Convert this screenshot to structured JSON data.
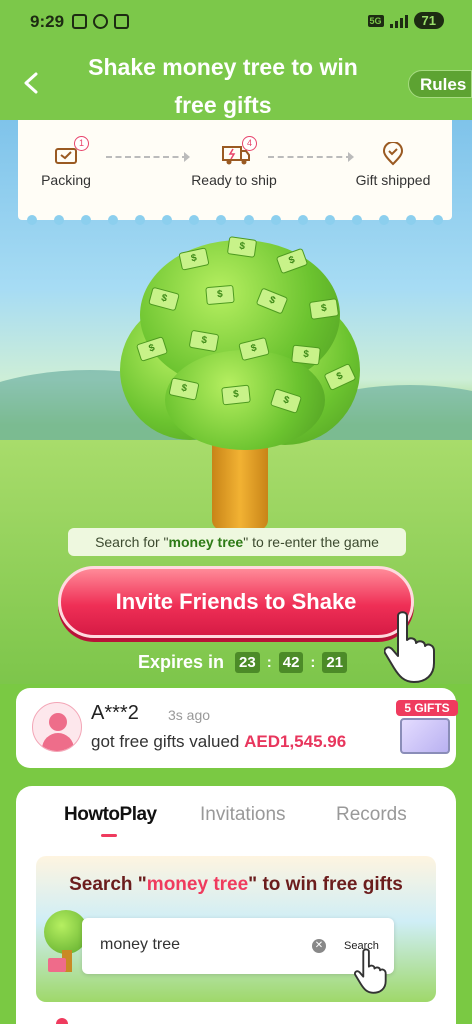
{
  "status_bar": {
    "time": "9:29",
    "network": "5G",
    "battery": "71"
  },
  "header": {
    "title": "Shake money tree to win free gifts",
    "rules_label": "Rules"
  },
  "progress": {
    "steps": [
      {
        "label": "Packing",
        "badge": "1"
      },
      {
        "label": "Ready to ship",
        "badge": "4"
      },
      {
        "label": "Gift shipped"
      }
    ]
  },
  "tree_hint": {
    "prefix": "Search for \"",
    "keyword": "money tree",
    "suffix": "\" to re-enter the game"
  },
  "invite_button": {
    "label": "Invite Friends to Shake"
  },
  "expires": {
    "label": "Expires in",
    "hours": "23",
    "minutes": "42",
    "seconds": "21"
  },
  "activity": {
    "user": "A***2",
    "time_ago": "3s ago",
    "message": "got free gifts valued",
    "amount": "AED1,545.96",
    "gifts_badge": "5 GIFTS"
  },
  "tabs": [
    {
      "label": "HowtoPlay",
      "active": true
    },
    {
      "label": "Invitations",
      "active": false
    },
    {
      "label": "Records",
      "active": false
    }
  ],
  "how_to_play": {
    "title_prefix": "Search \"",
    "title_keyword": "money tree",
    "title_suffix": "\" to win free gifts",
    "search_value": "money tree",
    "search_button": "Search"
  },
  "colors": {
    "accent": "#ef3b5e",
    "header_green": "#7cc84a",
    "dark_green": "#4c8b28"
  }
}
